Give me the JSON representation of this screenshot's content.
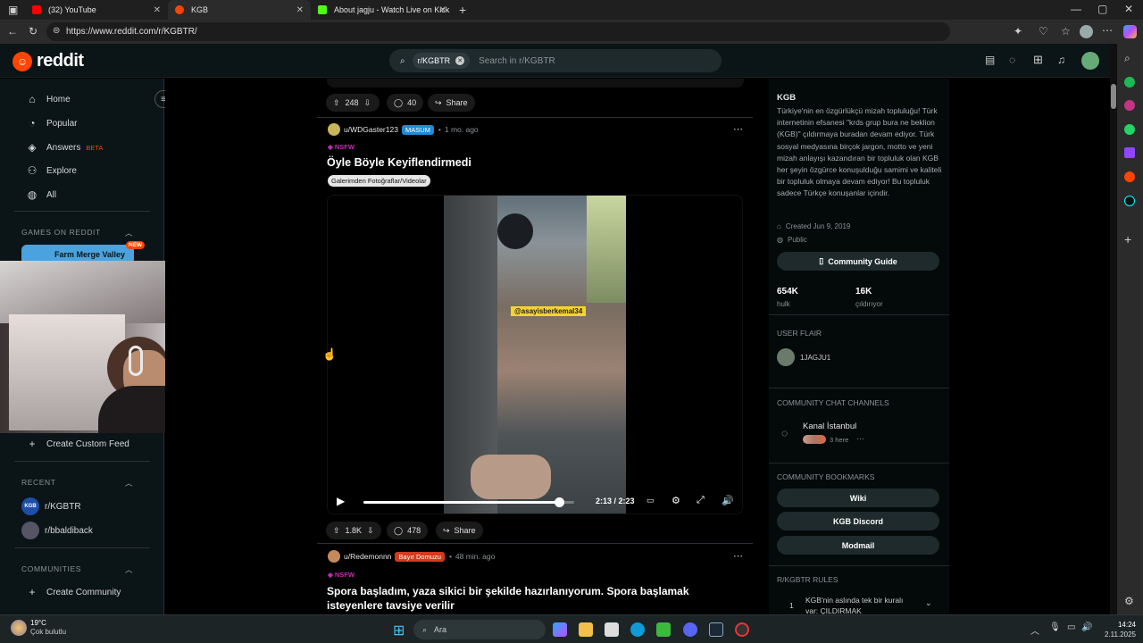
{
  "browser": {
    "tabs": [
      {
        "label": "(32) YouTube",
        "color": "#ff0000"
      },
      {
        "label": "KGB",
        "color": "#ff4500"
      },
      {
        "label": "About jagju - Watch Live on Kick",
        "color": "#53fc18"
      }
    ],
    "url": "https://www.reddit.com/r/KGBTR/"
  },
  "header": {
    "logo_text": "reddit",
    "search_chip": "r/KGBTR",
    "search_placeholder": "Search in r/KGBTR"
  },
  "leftnav": {
    "items": [
      {
        "label": "Home",
        "icon": "home-icon"
      },
      {
        "label": "Popular",
        "icon": "popular-icon"
      },
      {
        "label": "Answers",
        "icon": "answers-icon",
        "badge": "BETA"
      },
      {
        "label": "Explore",
        "icon": "explore-icon"
      },
      {
        "label": "All",
        "icon": "all-icon"
      }
    ],
    "games_title": "GAMES ON REDDIT",
    "game_label": "Farm Merge Valley",
    "game_badge": "NEW",
    "create_feed": "Create Custom Feed",
    "recent_title": "RECENT",
    "recent": [
      {
        "label": "r/KGBTR",
        "avatar": "KGB"
      },
      {
        "label": "r/bbaldiback"
      }
    ],
    "communities_title": "COMMUNITIES",
    "create_community": "Create Community"
  },
  "posts": [
    {
      "upvotes": "248",
      "comments": "40",
      "share": "Share"
    },
    {
      "author": "u/WDGaster123",
      "flair": "MASUM",
      "time": "1 mo. ago",
      "nsfw": "NSFW",
      "title": "Öyle Böyle Keyiflendirmedi",
      "tag": "Galerimden Fotoğraflar/Videolar",
      "video_caption": "@asayisberkemal34",
      "video_time": "2:13 / 2:23",
      "video_progress": 0.93,
      "upvotes": "1.8K",
      "comments": "478",
      "share": "Share"
    },
    {
      "author": "u/Redemonnn",
      "flair": "Bayır Domuzu",
      "time": "48 min. ago",
      "nsfw": "NSFW",
      "title": "Spora başladım, yaza sikici bir şekilde hazırlanıyorum. Spora başlamak isteyenlere tavsiye verilir"
    }
  ],
  "sidebar": {
    "name": "KGB",
    "description": "Türkiye'nin en özgürlükçü mizah topluluğu! Türk internetinin efsanesi \"krds grup bura ne beklion (KGB)\" çıldırmaya buradan devam ediyor. Türk sosyal medyasına birçok jargon, motto ve yeni mizah anlayışı kazandıran bir topluluk olan KGB her şeyin özgürce konuşulduğu samimi ve kaliteli bir topluluk olmaya devam ediyor! Bu topluluk sadece Türkçe konuşanlar içindir.",
    "created": "Created Jun 9, 2019",
    "visibility": "Public",
    "guide_btn": "Community Guide",
    "stat1_value": "654K",
    "stat1_label": "hulk",
    "stat2_value": "16K",
    "stat2_label": "çıldırıyor",
    "user_flair_title": "USER FLAIR",
    "user_flair": "1JAGJU1",
    "chat_title": "COMMUNITY CHAT CHANNELS",
    "chat_name": "Kanal İstanbul",
    "chat_here": "3 here",
    "bookmarks_title": "COMMUNITY BOOKMARKS",
    "bookmarks": [
      "Wiki",
      "KGB Discord",
      "Modmail"
    ],
    "rules_title": "R/KGBTR RULES",
    "rule1_num": "1",
    "rule1": "KGB'nin aslında tek bir kuralı var: ÇILDIRMAK"
  },
  "taskbar": {
    "temp": "19°C",
    "weather": "Çok bulutlu",
    "search": "Ara",
    "time": "14:24",
    "date": "2.11.2025"
  }
}
